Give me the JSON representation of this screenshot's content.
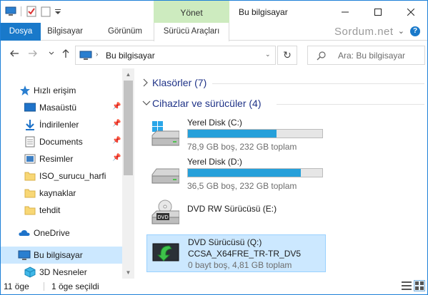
{
  "title_bar": {
    "context_tab": "Yönet",
    "window_title": "Bu bilgisayar"
  },
  "ribbon": {
    "tabs": [
      "Dosya",
      "Bilgisayar",
      "Görünüm",
      "Sürücü Araçları"
    ],
    "watermark": "Sordum.net"
  },
  "address": {
    "location": "Bu bilgisayar",
    "search_placeholder": "Ara: Bu bilgisayar"
  },
  "sidebar": {
    "quick_access": "Hızlı erişim",
    "items": [
      {
        "label": "Masaüstü",
        "icon": "desktop-icon",
        "pinned": true
      },
      {
        "label": "İndirilenler",
        "icon": "download-icon",
        "pinned": true
      },
      {
        "label": "Documents",
        "icon": "document-icon",
        "pinned": true
      },
      {
        "label": "Resimler",
        "icon": "pictures-icon",
        "pinned": true
      },
      {
        "label": "ISO_surucu_harfi",
        "icon": "folder-icon",
        "pinned": false
      },
      {
        "label": "kaynaklar",
        "icon": "folder-icon",
        "pinned": false
      },
      {
        "label": "tehdit",
        "icon": "folder-icon",
        "pinned": false
      }
    ],
    "onedrive": "OneDrive",
    "this_pc": "Bu bilgisayar",
    "objects3d": "3D Nesneler"
  },
  "content": {
    "folders_group": "Klasörler (7)",
    "devices_group": "Cihazlar ve sürücüler (4)",
    "drives": [
      {
        "name": "Yerel Disk (C:)",
        "details": "78,9 GB boş, 232 GB toplam",
        "used_fraction": 0.66,
        "icon": "windows-drive-icon"
      },
      {
        "name": "Yerel Disk (D:)",
        "details": "36,5 GB boş, 232 GB toplam",
        "used_fraction": 0.84,
        "icon": "hard-drive-icon"
      },
      {
        "name": "DVD RW Sürücüsü (E:)",
        "icon": "dvd-drive-icon"
      },
      {
        "name": "DVD Sürücüsü (Q:)",
        "label": "CCSA_X64FRE_TR-TR_DV5",
        "details": "0 bayt boş, 4,81 GB toplam",
        "icon": "iso-mount-icon",
        "selected": true
      }
    ]
  },
  "status": {
    "item_count": "11 öge",
    "selected_count": "1 öge seçildi"
  },
  "colors": {
    "accent": "#1979ca",
    "selection": "#cce8ff",
    "bar_fill": "#26a0da",
    "context_tab": "#cdebbf"
  }
}
